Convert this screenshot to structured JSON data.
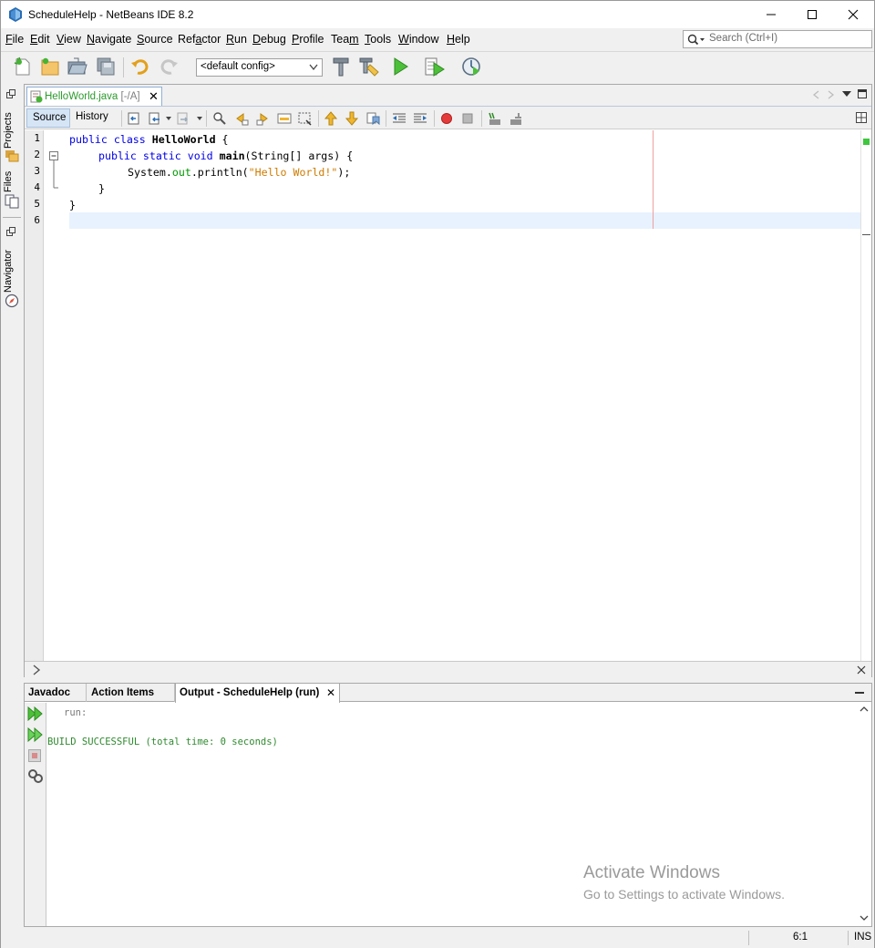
{
  "window": {
    "title": "ScheduleHelp - NetBeans IDE 8.2",
    "controls": {
      "minimize": "–",
      "maximize": "☐",
      "close": "✕"
    }
  },
  "menu": {
    "items": [
      {
        "label": "File",
        "u": "F",
        "rest": "ile"
      },
      {
        "label": "Edit",
        "u": "E",
        "rest": "dit"
      },
      {
        "label": "View",
        "u": "V",
        "rest": "iew"
      },
      {
        "label": "Navigate",
        "u": "N",
        "rest": "avigate"
      },
      {
        "label": "Source",
        "u": "S",
        "rest": "ource"
      },
      {
        "label": "Refactor",
        "pre": "Ref",
        "u": "a",
        "rest": "ctor"
      },
      {
        "label": "Run",
        "u": "R",
        "rest": "un"
      },
      {
        "label": "Debug",
        "u": "D",
        "rest": "ebug"
      },
      {
        "label": "Profile",
        "u": "P",
        "rest": "rofile"
      },
      {
        "label": "Team",
        "pre": "Tea",
        "u": "m",
        "rest": ""
      },
      {
        "label": "Tools",
        "u": "T",
        "rest": "ools"
      },
      {
        "label": "Window",
        "u": "W",
        "rest": "indow"
      },
      {
        "label": "Help",
        "u": "H",
        "rest": "elp"
      }
    ],
    "search_placeholder": "Search (Ctrl+I)"
  },
  "toolbar": {
    "config_value": "<default config>"
  },
  "sidebar": {
    "tabs": [
      "Projects",
      "Files",
      "Navigator"
    ]
  },
  "editor": {
    "file_tab": "HelloWorld.java",
    "file_tab_suffix": " [-/A]",
    "source_tab": "Source",
    "history_tab": "History",
    "line_numbers": [
      "1",
      "2",
      "3",
      "4",
      "5",
      "6"
    ],
    "code": {
      "l1_kw": "public class ",
      "l1_name": "HelloWorld",
      "l1_rest": " {",
      "l2_kw": "public static void ",
      "l2_name": "main",
      "l2_rest": "(String[] args) {",
      "l3_a": "System.",
      "l3_field": "out",
      "l3_b": ".println(",
      "l3_str": "\"Hello World!\"",
      "l3_c": ");",
      "l4": "}",
      "l5": "}"
    }
  },
  "output": {
    "tabs": [
      "Javadoc",
      "Action Items",
      "Output - ScheduleHelp (run)"
    ],
    "lines": [
      "run:",
      "BUILD SUCCESSFUL (total time: 0 seconds)"
    ],
    "watermark_title": "Activate Windows",
    "watermark_sub": "Go to Settings to activate Windows."
  },
  "status": {
    "position": "6:1",
    "mode": "INS"
  },
  "colors": {
    "keyword": "#0000e6",
    "string": "#ce7b00",
    "field": "#009900",
    "build_success": "#2f8a2f",
    "current_line": "#e8f2fe"
  }
}
